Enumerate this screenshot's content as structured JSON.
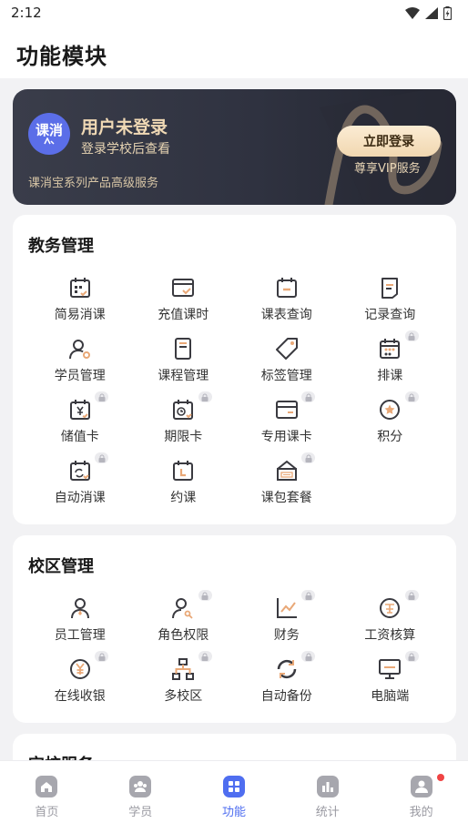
{
  "status_bar": {
    "time": "2:12"
  },
  "header": {
    "title": "功能模块"
  },
  "login_card": {
    "avatar_text": "课消",
    "title": "用户未登录",
    "subtitle": "登录学校后查看",
    "footer": "课消宝系列产品高级服务",
    "button_label": "立即登录",
    "vip_text": "尊享VIP服务"
  },
  "sections": [
    {
      "title": "教务管理",
      "items": [
        {
          "label": "简易消课",
          "icon": "calendar-grid-icon",
          "locked": false
        },
        {
          "label": "充值课时",
          "icon": "browser-check-icon",
          "locked": false
        },
        {
          "label": "课表查询",
          "icon": "calendar-minus-icon",
          "locked": false
        },
        {
          "label": "记录查询",
          "icon": "document-icon",
          "locked": false
        },
        {
          "label": "学员管理",
          "icon": "user-gear-icon",
          "locked": false
        },
        {
          "label": "课程管理",
          "icon": "notebook-icon",
          "locked": false
        },
        {
          "label": "标签管理",
          "icon": "tag-icon",
          "locked": false
        },
        {
          "label": "排课",
          "icon": "calendar-dots-icon",
          "locked": true
        },
        {
          "label": "储值卡",
          "icon": "calendar-yen-icon",
          "locked": true
        },
        {
          "label": "期限卡",
          "icon": "calendar-clock-icon",
          "locked": true
        },
        {
          "label": "专用课卡",
          "icon": "card-icon",
          "locked": true
        },
        {
          "label": "积分",
          "icon": "star-circle-icon",
          "locked": true
        },
        {
          "label": "自动消课",
          "icon": "calendar-refresh-icon",
          "locked": true
        },
        {
          "label": "约课",
          "icon": "calendar-l-icon",
          "locked": false
        },
        {
          "label": "课包套餐",
          "icon": "sale-bag-icon",
          "locked": true
        }
      ]
    },
    {
      "title": "校区管理",
      "items": [
        {
          "label": "员工管理",
          "icon": "employee-icon",
          "locked": false
        },
        {
          "label": "角色权限",
          "icon": "role-key-icon",
          "locked": true
        },
        {
          "label": "财务",
          "icon": "chart-trend-icon",
          "locked": true
        },
        {
          "label": "工资核算",
          "icon": "salary-icon",
          "locked": true
        },
        {
          "label": "在线收银",
          "icon": "yen-circle-icon",
          "locked": true
        },
        {
          "label": "多校区",
          "icon": "org-chart-icon",
          "locked": true
        },
        {
          "label": "自动备份",
          "icon": "sync-icon",
          "locked": true
        },
        {
          "label": "电脑端",
          "icon": "monitor-icon",
          "locked": true
        }
      ]
    },
    {
      "title": "完校服务"
    }
  ],
  "tabs": [
    {
      "label": "首页",
      "icon": "home-icon",
      "active": false
    },
    {
      "label": "学员",
      "icon": "students-icon",
      "active": false
    },
    {
      "label": "功能",
      "icon": "grid-icon",
      "active": true
    },
    {
      "label": "统计",
      "icon": "bar-chart-icon",
      "active": false
    },
    {
      "label": "我的",
      "icon": "profile-icon",
      "active": false,
      "notification_dot": true
    }
  ],
  "colors": {
    "accent": "#4f6ef0",
    "icon_stroke": "#3a3a40",
    "icon_accent": "#e9a877",
    "login_gold": "#f0d9b5"
  }
}
